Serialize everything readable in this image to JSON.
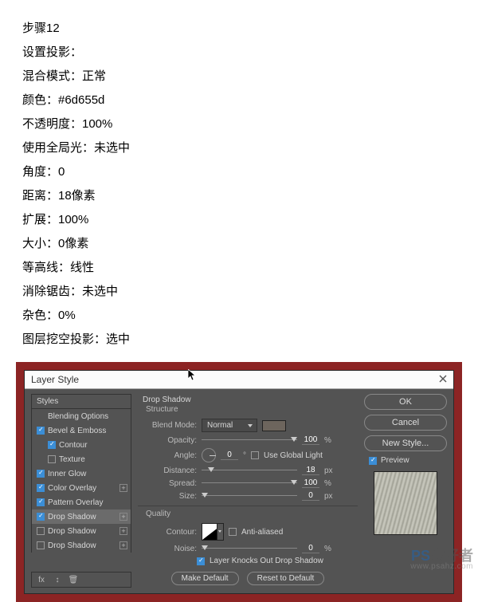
{
  "doc": {
    "step": "步骤12",
    "intro": "设置投影：",
    "lines": [
      "混合模式：正常",
      "颜色：#6d655d",
      "不透明度：100%",
      "使用全局光：未选中",
      "角度：0",
      "距离：18像素",
      "扩展：100%",
      "大小：0像素",
      "等高线：线性",
      "消除锯齿：未选中",
      "杂色：0%",
      "图层挖空投影：选中"
    ]
  },
  "dialog": {
    "title": "Layer Style",
    "styles_header": "Styles",
    "items": [
      {
        "label": "Blending Options",
        "checkbox": false,
        "checked": false,
        "indent": false,
        "plus": false,
        "selected": false
      },
      {
        "label": "Bevel & Emboss",
        "checkbox": true,
        "checked": true,
        "indent": false,
        "plus": false,
        "selected": false
      },
      {
        "label": "Contour",
        "checkbox": true,
        "checked": true,
        "indent": true,
        "plus": false,
        "selected": false
      },
      {
        "label": "Texture",
        "checkbox": true,
        "checked": false,
        "indent": true,
        "plus": false,
        "selected": false
      },
      {
        "label": "Inner Glow",
        "checkbox": true,
        "checked": true,
        "indent": false,
        "plus": false,
        "selected": false
      },
      {
        "label": "Color Overlay",
        "checkbox": true,
        "checked": true,
        "indent": false,
        "plus": true,
        "selected": false
      },
      {
        "label": "Pattern Overlay",
        "checkbox": true,
        "checked": true,
        "indent": false,
        "plus": false,
        "selected": false
      },
      {
        "label": "Drop Shadow",
        "checkbox": true,
        "checked": true,
        "indent": false,
        "plus": true,
        "selected": true
      },
      {
        "label": "Drop Shadow",
        "checkbox": true,
        "checked": false,
        "indent": false,
        "plus": true,
        "selected": false
      },
      {
        "label": "Drop Shadow",
        "checkbox": true,
        "checked": false,
        "indent": false,
        "plus": true,
        "selected": false
      }
    ],
    "mid": {
      "section": "Drop Shadow",
      "structure": "Structure",
      "blend_label": "Blend Mode:",
      "blend_value": "Normal",
      "opacity_label": "Opacity:",
      "opacity_value": "100",
      "opacity_unit": "%",
      "angle_label": "Angle:",
      "angle_value": "0",
      "angle_unit": "°",
      "global_label": "Use Global Light",
      "distance_label": "Distance:",
      "distance_value": "18",
      "distance_unit": "px",
      "spread_label": "Spread:",
      "spread_value": "100",
      "spread_unit": "%",
      "size_label": "Size:",
      "size_value": "0",
      "size_unit": "px",
      "quality": "Quality",
      "contour_label": "Contour:",
      "antialias_label": "Anti-aliased",
      "noise_label": "Noise:",
      "noise_value": "0",
      "noise_unit": "%",
      "knockout_label": "Layer Knocks Out Drop Shadow",
      "make_default": "Make Default",
      "reset_default": "Reset to Default"
    },
    "right": {
      "ok": "OK",
      "cancel": "Cancel",
      "newstyle": "New Style...",
      "preview": "Preview"
    },
    "footer_icons": [
      "fx",
      "↕",
      "🗑"
    ]
  },
  "watermark": {
    "brand": "PS",
    "brand2": "爱好者",
    "url": "www.psahz.com"
  }
}
